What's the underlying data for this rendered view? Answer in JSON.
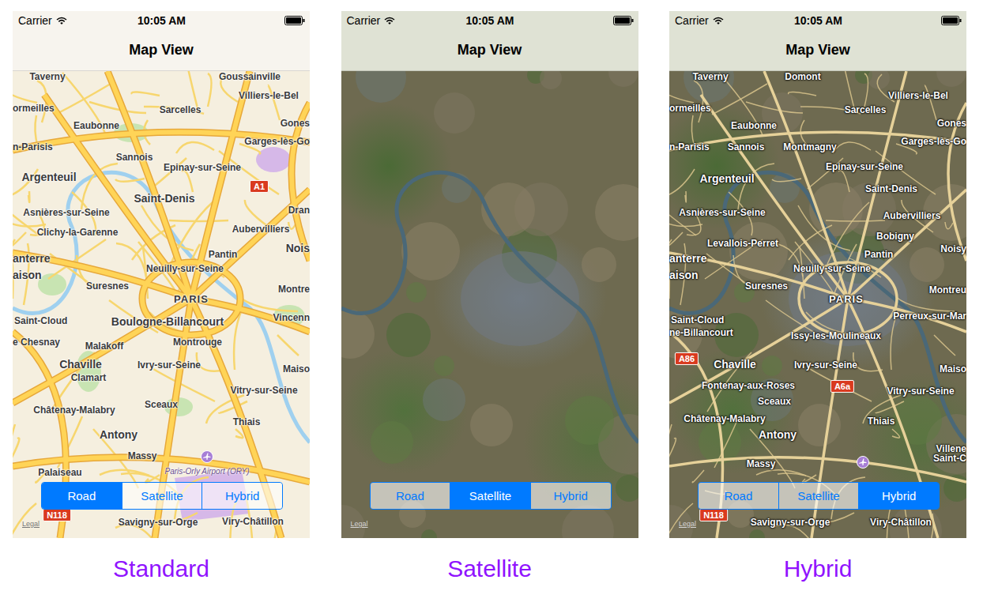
{
  "screens": [
    {
      "caption": "Standard",
      "status_bar": {
        "carrier": "Carrier",
        "time": "10:05 AM"
      },
      "title": "Map View",
      "labels": [
        {
          "text": "Taverny",
          "kind": "town"
        },
        {
          "text": "Goussainville",
          "kind": "town"
        },
        {
          "text": "Villiers-le-Bel",
          "kind": "town"
        },
        {
          "text": "ormeilles",
          "kind": "town"
        },
        {
          "text": "Sarcelles",
          "kind": "town"
        },
        {
          "text": "Gones",
          "kind": "town"
        },
        {
          "text": "Eaubonne",
          "kind": "town"
        },
        {
          "text": "Garges-lès-Go",
          "kind": "town"
        },
        {
          "text": "n-Parisis",
          "kind": "town"
        },
        {
          "text": "Sannois",
          "kind": "town"
        },
        {
          "text": "Epinay-sur-Seine",
          "kind": "town"
        },
        {
          "text": "Argenteuil",
          "kind": "city"
        },
        {
          "text": "Saint-Denis",
          "kind": "city"
        },
        {
          "text": "Dran",
          "kind": "town"
        },
        {
          "text": "Asnières-sur-Seine",
          "kind": "town"
        },
        {
          "text": "Aubervilliers",
          "kind": "town"
        },
        {
          "text": "Clichy-la-Garenne",
          "kind": "town"
        },
        {
          "text": "Nois",
          "kind": "city"
        },
        {
          "text": "anterre",
          "kind": "city"
        },
        {
          "text": "Pantin",
          "kind": "town"
        },
        {
          "text": "aison",
          "kind": "city"
        },
        {
          "text": "Neuilly-sur-Seine",
          "kind": "town"
        },
        {
          "text": "Suresnes",
          "kind": "town"
        },
        {
          "text": "Montre",
          "kind": "town"
        },
        {
          "text": "PARIS",
          "kind": "capital"
        },
        {
          "text": "Saint-Cloud",
          "kind": "town"
        },
        {
          "text": "Boulogne-Billancourt",
          "kind": "city"
        },
        {
          "text": "Vincenn",
          "kind": "town"
        },
        {
          "text": "e Chesnay",
          "kind": "town"
        },
        {
          "text": "Malakoff",
          "kind": "town"
        },
        {
          "text": "Montrouge",
          "kind": "town"
        },
        {
          "text": "Chaville",
          "kind": "city"
        },
        {
          "text": "Ivry-sur-Seine",
          "kind": "town"
        },
        {
          "text": "Maiso",
          "kind": "town"
        },
        {
          "text": "Clamart",
          "kind": "town"
        },
        {
          "text": "Vitry-sur-Seine",
          "kind": "town"
        },
        {
          "text": "Châtenay-Malabry",
          "kind": "town"
        },
        {
          "text": "Sceaux",
          "kind": "town"
        },
        {
          "text": "Thiais",
          "kind": "town"
        },
        {
          "text": "Antony",
          "kind": "city"
        },
        {
          "text": "Massy",
          "kind": "town"
        },
        {
          "text": "Palaiseau",
          "kind": "town"
        },
        {
          "text": "Savigny-sur-Orge",
          "kind": "town"
        },
        {
          "text": "Viry-Châtillon",
          "kind": "town"
        }
      ],
      "road_badges": [
        "A1",
        "N118"
      ],
      "airport_label": "Paris-Orly Airport (ORY)",
      "legal": "Legal",
      "segments": [
        {
          "label": "Road",
          "selected": true
        },
        {
          "label": "Satellite",
          "selected": false
        },
        {
          "label": "Hybrid",
          "selected": false
        }
      ]
    },
    {
      "caption": "Satellite",
      "status_bar": {
        "carrier": "Carrier",
        "time": "10:05 AM"
      },
      "title": "Map View",
      "labels": [],
      "road_badges": [],
      "legal": "Legal",
      "segments": [
        {
          "label": "Road",
          "selected": false
        },
        {
          "label": "Satellite",
          "selected": true
        },
        {
          "label": "Hybrid",
          "selected": false
        }
      ]
    },
    {
      "caption": "Hybrid",
      "status_bar": {
        "carrier": "Carrier",
        "time": "10:05 AM"
      },
      "title": "Map View",
      "labels": [
        {
          "text": "Taverny",
          "kind": "town"
        },
        {
          "text": "Domont",
          "kind": "town"
        },
        {
          "text": "Villiers-le-Bel",
          "kind": "town"
        },
        {
          "text": "ormeilles",
          "kind": "town"
        },
        {
          "text": "Sarcelles",
          "kind": "town"
        },
        {
          "text": "Gones",
          "kind": "town"
        },
        {
          "text": "Eaubonne",
          "kind": "town"
        },
        {
          "text": "Garges-lès-Go",
          "kind": "town"
        },
        {
          "text": "n-Parisis",
          "kind": "town"
        },
        {
          "text": "Sannois",
          "kind": "town"
        },
        {
          "text": "Montmagny",
          "kind": "town"
        },
        {
          "text": "Epinay-sur-Seine",
          "kind": "town"
        },
        {
          "text": "Argenteuil",
          "kind": "city"
        },
        {
          "text": "Saint-Denis",
          "kind": "town"
        },
        {
          "text": "Asnières-sur-Seine",
          "kind": "town"
        },
        {
          "text": "Aubervilliers",
          "kind": "town"
        },
        {
          "text": "Bobigny",
          "kind": "town"
        },
        {
          "text": "Levallois-Perret",
          "kind": "town"
        },
        {
          "text": "Noisy",
          "kind": "town"
        },
        {
          "text": "Pantin",
          "kind": "town"
        },
        {
          "text": "anterre",
          "kind": "city"
        },
        {
          "text": "Neuilly-sur-Seine",
          "kind": "town"
        },
        {
          "text": "aison",
          "kind": "city"
        },
        {
          "text": "Suresnes",
          "kind": "town"
        },
        {
          "text": "Montreu",
          "kind": "town"
        },
        {
          "text": "PARIS",
          "kind": "capital"
        },
        {
          "text": "Perreux-sur-Mar",
          "kind": "town"
        },
        {
          "text": "Saint-Cloud",
          "kind": "town"
        },
        {
          "text": "ne-Billancourt",
          "kind": "town"
        },
        {
          "text": "Issy-les-Moulineaux",
          "kind": "town"
        },
        {
          "text": "Chaville",
          "kind": "city"
        },
        {
          "text": "Ivry-sur-Seine",
          "kind": "town"
        },
        {
          "text": "Maiso",
          "kind": "town"
        },
        {
          "text": "Fontenay-aux-Roses",
          "kind": "town"
        },
        {
          "text": "Vitry-sur-Seine",
          "kind": "town"
        },
        {
          "text": "Sceaux",
          "kind": "town"
        },
        {
          "text": "Châtenay-Malabry",
          "kind": "town"
        },
        {
          "text": "Thiais",
          "kind": "town"
        },
        {
          "text": "Antony",
          "kind": "city"
        },
        {
          "text": "Villene",
          "kind": "town"
        },
        {
          "text": "Saint-C",
          "kind": "town"
        },
        {
          "text": "Massy",
          "kind": "town"
        },
        {
          "text": "Savigny-sur-Orge",
          "kind": "town"
        },
        {
          "text": "Viry-Châtillon",
          "kind": "town"
        }
      ],
      "road_badges": [
        "A86",
        "A6a",
        "N118"
      ],
      "legal": "Legal",
      "segments": [
        {
          "label": "Road",
          "selected": false
        },
        {
          "label": "Satellite",
          "selected": false
        },
        {
          "label": "Hybrid",
          "selected": true
        }
      ]
    }
  ]
}
